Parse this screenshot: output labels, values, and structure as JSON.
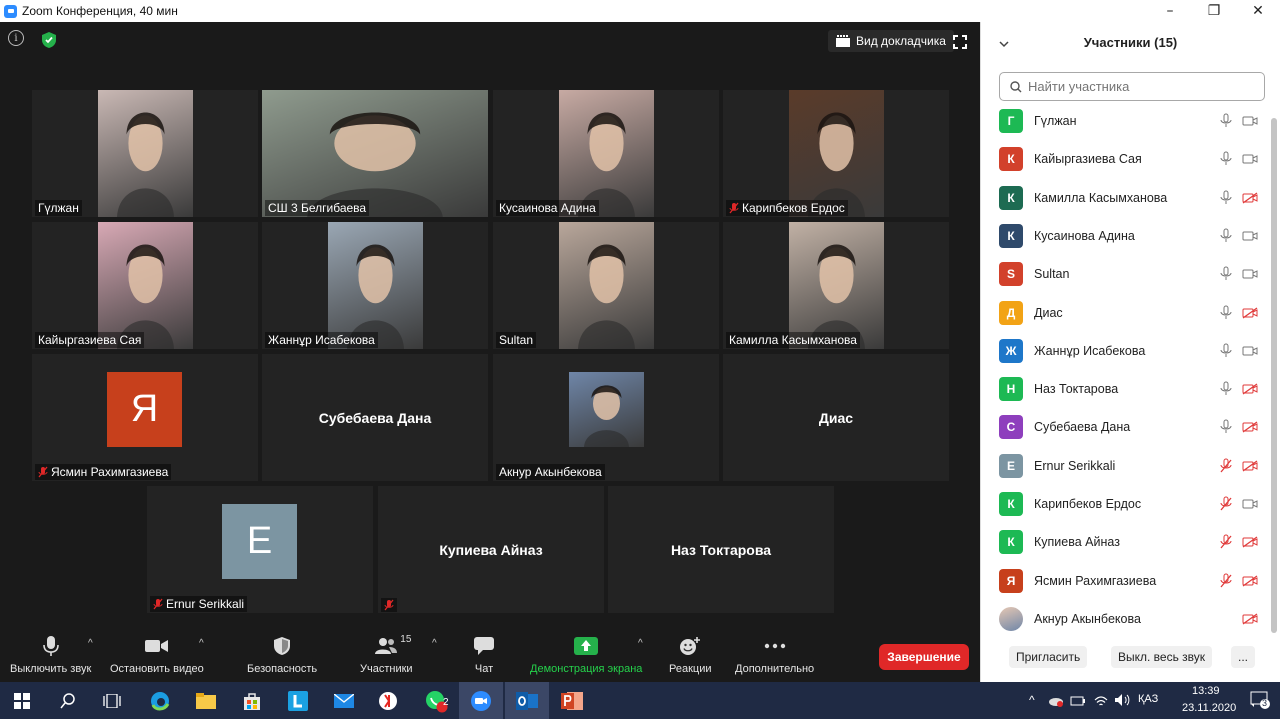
{
  "window": {
    "title": "Zoom Конференция, 40 мин",
    "minimize": "–",
    "maximize": "❐",
    "close": "✕"
  },
  "meeting": {
    "speaker_view_label": "Вид докладчика",
    "tiles": [
      {
        "name": "Гүлжан",
        "muted": false,
        "video": true,
        "color": "#c9b8b4"
      },
      {
        "name": "СШ 3 Белгибаева",
        "muted": false,
        "video": true,
        "active": true,
        "color": "#8f9b8e"
      },
      {
        "name": "Кусаинова Адина",
        "muted": false,
        "video": true,
        "color": "#c7aaa3"
      },
      {
        "name": "Карипбеков Ердос",
        "muted": true,
        "video": true,
        "color": "#5a3b2a"
      },
      {
        "name": "Кайыргазиева Сая",
        "muted": false,
        "video": true,
        "color": "#d8a9b5"
      },
      {
        "name": "Жаннұр Исабекова",
        "muted": false,
        "video": true,
        "color": "#9aa7b4"
      },
      {
        "name": "Sultan",
        "muted": false,
        "video": true,
        "color": "#b9a79b"
      },
      {
        "name": "Камилла Касымханова",
        "muted": false,
        "video": true,
        "color": "#c1b1a5"
      },
      {
        "name": "Ясмин Рахимгазиева",
        "muted": true,
        "video": false,
        "avatar_letter": "Я",
        "avatar_color": "#c7401c"
      },
      {
        "name": "Субебаева Дана",
        "muted": false,
        "video": false,
        "big": true
      },
      {
        "name": "Акнур Акынбекова",
        "muted": false,
        "video": true,
        "color": "#6f86a8"
      },
      {
        "name": "Диас",
        "muted": false,
        "video": false,
        "big": true
      },
      {
        "name": "Ernur Serikkali",
        "muted": true,
        "video": false,
        "avatar_letter": "E",
        "avatar_color": "#7c95a2"
      },
      {
        "name": "Купиева Айназ",
        "muted": true,
        "video": false,
        "big": true,
        "big_label": "Купиева Айназ",
        "show_tag": true
      },
      {
        "name": "Наз Токтарова",
        "muted": false,
        "video": false,
        "big": true
      }
    ]
  },
  "toolbar": {
    "mute": "Выключить звук",
    "stop_video": "Остановить видео",
    "security": "Безопасность",
    "participants": "Участники",
    "participants_count": "15",
    "chat": "Чат",
    "share_screen": "Демонстрация экрана",
    "reactions": "Реакции",
    "more": "Дополнительно",
    "end": "Завершение"
  },
  "panel": {
    "title": "Участники (15)",
    "search_placeholder": "Найти участника",
    "participants": [
      {
        "letter": "Г",
        "color": "#1db954",
        "name": "Гүлжан",
        "mic_muted": false,
        "cam_off": false
      },
      {
        "letter": "К",
        "color": "#d2412b",
        "name": "Кайыргазиева Сая",
        "mic_muted": false,
        "cam_off": false
      },
      {
        "letter": "К",
        "color": "#1d6b52",
        "name": "Камилла Касымханова",
        "mic_muted": false,
        "cam_off": true
      },
      {
        "letter": "К",
        "color": "#2f4a6b",
        "name": "Кусаинова Адина",
        "mic_muted": false,
        "cam_off": false
      },
      {
        "letter": "S",
        "color": "#d2412b",
        "name": "Sultan",
        "mic_muted": false,
        "cam_off": false
      },
      {
        "letter": "Д",
        "color": "#f2a316",
        "name": "Диас",
        "mic_muted": false,
        "cam_off": true
      },
      {
        "letter": "Ж",
        "color": "#1e77c9",
        "name": "Жаннұр Исабекова",
        "mic_muted": false,
        "cam_off": false
      },
      {
        "letter": "Н",
        "color": "#1db954",
        "name": "Наз Токтарова",
        "mic_muted": false,
        "cam_off": true
      },
      {
        "letter": "С",
        "color": "#8e3fbd",
        "name": "Субебаева Дана",
        "mic_muted": false,
        "cam_off": true
      },
      {
        "letter": "E",
        "color": "#7c95a2",
        "name": "Ernur Serikkali",
        "mic_muted": true,
        "cam_off": true
      },
      {
        "letter": "К",
        "color": "#1db954",
        "name": "Карипбеков Ердос",
        "mic_muted": true,
        "cam_off": false
      },
      {
        "letter": "К",
        "color": "#1db954",
        "name": "Купиева Айназ",
        "mic_muted": true,
        "cam_off": true
      },
      {
        "letter": "Я",
        "color": "#c7401c",
        "name": "Ясмин Рахимгазиева",
        "mic_muted": true,
        "cam_off": true
      },
      {
        "letter": "",
        "color": "#6f86a8",
        "name": "Акнур Акынбекова",
        "mic_muted": null,
        "cam_off": true,
        "photo": true
      }
    ],
    "invite": "Пригласить",
    "mute_all": "Выкл. весь звук",
    "more": "..."
  },
  "taskbar": {
    "lang": "ҚАЗ",
    "time": "13:39",
    "date": "23.11.2020",
    "notifications": "3",
    "whatsapp_badge": "2"
  }
}
